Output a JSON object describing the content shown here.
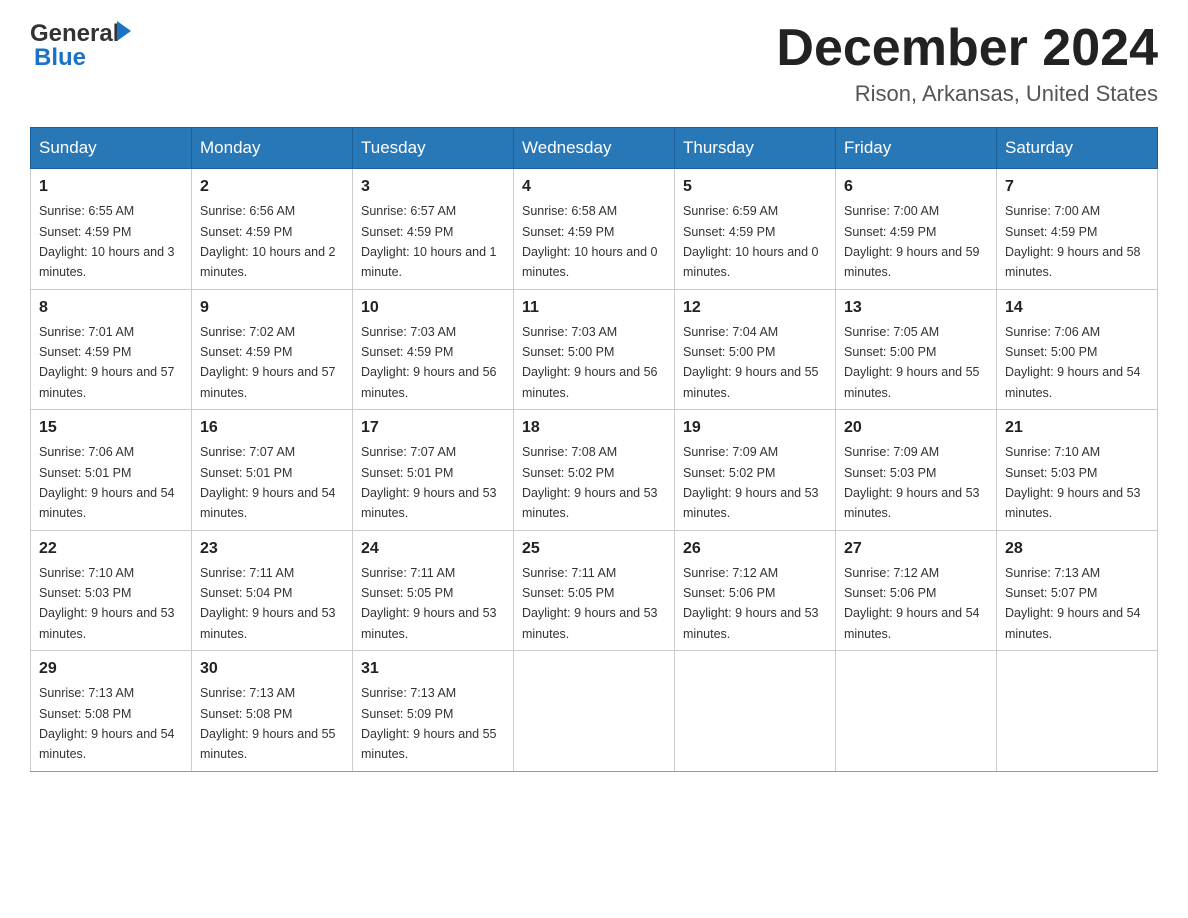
{
  "header": {
    "logo_general": "General",
    "logo_blue": "Blue",
    "month_title": "December 2024",
    "location": "Rison, Arkansas, United States"
  },
  "weekdays": [
    "Sunday",
    "Monday",
    "Tuesday",
    "Wednesday",
    "Thursday",
    "Friday",
    "Saturday"
  ],
  "weeks": [
    [
      {
        "day": "1",
        "sunrise": "6:55 AM",
        "sunset": "4:59 PM",
        "daylight": "10 hours and 3 minutes."
      },
      {
        "day": "2",
        "sunrise": "6:56 AM",
        "sunset": "4:59 PM",
        "daylight": "10 hours and 2 minutes."
      },
      {
        "day": "3",
        "sunrise": "6:57 AM",
        "sunset": "4:59 PM",
        "daylight": "10 hours and 1 minute."
      },
      {
        "day": "4",
        "sunrise": "6:58 AM",
        "sunset": "4:59 PM",
        "daylight": "10 hours and 0 minutes."
      },
      {
        "day": "5",
        "sunrise": "6:59 AM",
        "sunset": "4:59 PM",
        "daylight": "10 hours and 0 minutes."
      },
      {
        "day": "6",
        "sunrise": "7:00 AM",
        "sunset": "4:59 PM",
        "daylight": "9 hours and 59 minutes."
      },
      {
        "day": "7",
        "sunrise": "7:00 AM",
        "sunset": "4:59 PM",
        "daylight": "9 hours and 58 minutes."
      }
    ],
    [
      {
        "day": "8",
        "sunrise": "7:01 AM",
        "sunset": "4:59 PM",
        "daylight": "9 hours and 57 minutes."
      },
      {
        "day": "9",
        "sunrise": "7:02 AM",
        "sunset": "4:59 PM",
        "daylight": "9 hours and 57 minutes."
      },
      {
        "day": "10",
        "sunrise": "7:03 AM",
        "sunset": "4:59 PM",
        "daylight": "9 hours and 56 minutes."
      },
      {
        "day": "11",
        "sunrise": "7:03 AM",
        "sunset": "5:00 PM",
        "daylight": "9 hours and 56 minutes."
      },
      {
        "day": "12",
        "sunrise": "7:04 AM",
        "sunset": "5:00 PM",
        "daylight": "9 hours and 55 minutes."
      },
      {
        "day": "13",
        "sunrise": "7:05 AM",
        "sunset": "5:00 PM",
        "daylight": "9 hours and 55 minutes."
      },
      {
        "day": "14",
        "sunrise": "7:06 AM",
        "sunset": "5:00 PM",
        "daylight": "9 hours and 54 minutes."
      }
    ],
    [
      {
        "day": "15",
        "sunrise": "7:06 AM",
        "sunset": "5:01 PM",
        "daylight": "9 hours and 54 minutes."
      },
      {
        "day": "16",
        "sunrise": "7:07 AM",
        "sunset": "5:01 PM",
        "daylight": "9 hours and 54 minutes."
      },
      {
        "day": "17",
        "sunrise": "7:07 AM",
        "sunset": "5:01 PM",
        "daylight": "9 hours and 53 minutes."
      },
      {
        "day": "18",
        "sunrise": "7:08 AM",
        "sunset": "5:02 PM",
        "daylight": "9 hours and 53 minutes."
      },
      {
        "day": "19",
        "sunrise": "7:09 AM",
        "sunset": "5:02 PM",
        "daylight": "9 hours and 53 minutes."
      },
      {
        "day": "20",
        "sunrise": "7:09 AM",
        "sunset": "5:03 PM",
        "daylight": "9 hours and 53 minutes."
      },
      {
        "day": "21",
        "sunrise": "7:10 AM",
        "sunset": "5:03 PM",
        "daylight": "9 hours and 53 minutes."
      }
    ],
    [
      {
        "day": "22",
        "sunrise": "7:10 AM",
        "sunset": "5:03 PM",
        "daylight": "9 hours and 53 minutes."
      },
      {
        "day": "23",
        "sunrise": "7:11 AM",
        "sunset": "5:04 PM",
        "daylight": "9 hours and 53 minutes."
      },
      {
        "day": "24",
        "sunrise": "7:11 AM",
        "sunset": "5:05 PM",
        "daylight": "9 hours and 53 minutes."
      },
      {
        "day": "25",
        "sunrise": "7:11 AM",
        "sunset": "5:05 PM",
        "daylight": "9 hours and 53 minutes."
      },
      {
        "day": "26",
        "sunrise": "7:12 AM",
        "sunset": "5:06 PM",
        "daylight": "9 hours and 53 minutes."
      },
      {
        "day": "27",
        "sunrise": "7:12 AM",
        "sunset": "5:06 PM",
        "daylight": "9 hours and 54 minutes."
      },
      {
        "day": "28",
        "sunrise": "7:13 AM",
        "sunset": "5:07 PM",
        "daylight": "9 hours and 54 minutes."
      }
    ],
    [
      {
        "day": "29",
        "sunrise": "7:13 AM",
        "sunset": "5:08 PM",
        "daylight": "9 hours and 54 minutes."
      },
      {
        "day": "30",
        "sunrise": "7:13 AM",
        "sunset": "5:08 PM",
        "daylight": "9 hours and 55 minutes."
      },
      {
        "day": "31",
        "sunrise": "7:13 AM",
        "sunset": "5:09 PM",
        "daylight": "9 hours and 55 minutes."
      },
      null,
      null,
      null,
      null
    ]
  ]
}
